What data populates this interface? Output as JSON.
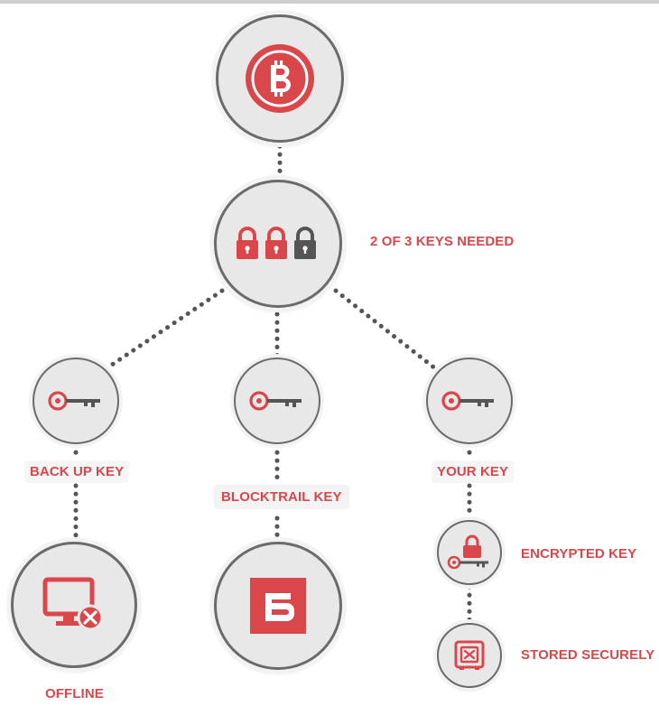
{
  "colors": {
    "accent": "#d9474a",
    "node_fill": "#e8e8e8",
    "node_border": "#6b6b6b",
    "dots": "#555555"
  },
  "nodes": {
    "bitcoin": {
      "icon": "bitcoin-icon"
    },
    "multisig": {
      "icon": "padlocks-icon",
      "label": "2 OF 3 KEYS NEEDED"
    },
    "backup_key": {
      "icon": "key-icon",
      "label": "BACK UP KEY"
    },
    "blocktrail_key": {
      "icon": "key-icon",
      "label": "BLOCKTRAIL KEY"
    },
    "your_key": {
      "icon": "key-icon",
      "label": "YOUR KEY"
    },
    "offline": {
      "icon": "offline-monitor-icon",
      "label": "OFFLINE"
    },
    "blocktrail": {
      "icon": "blocktrail-logo-icon"
    },
    "encrypted_key": {
      "icon": "encrypted-key-icon",
      "label": "ENCRYPTED KEY"
    },
    "stored_securely": {
      "icon": "safe-icon",
      "label": "STORED SECURELY"
    }
  }
}
